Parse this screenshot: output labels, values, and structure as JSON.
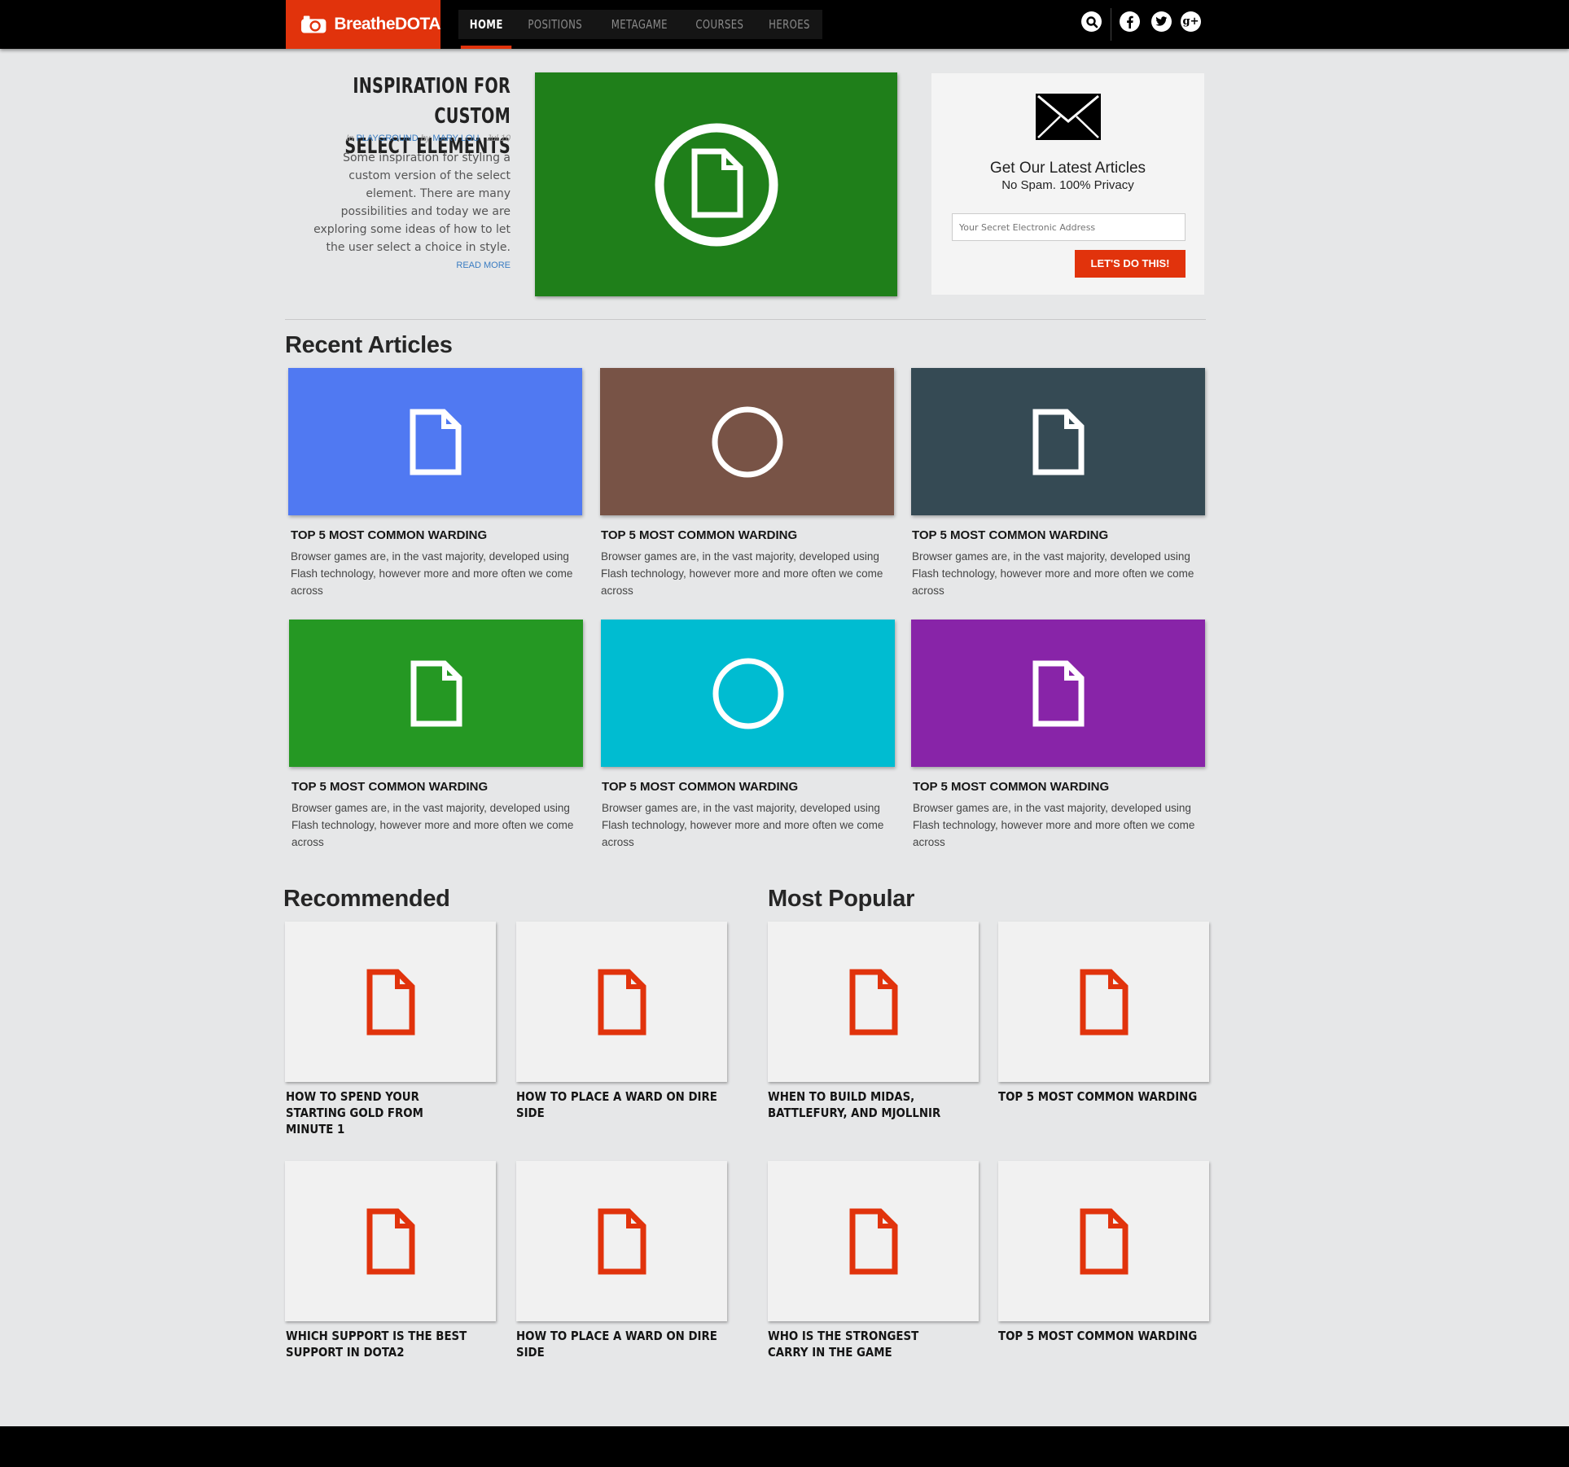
{
  "brand": {
    "name": "BreatheDOTA",
    "accent": "#e1330c"
  },
  "nav": [
    {
      "label": "HOME",
      "active": true
    },
    {
      "label": "POSITIONS",
      "active": false
    },
    {
      "label": "METAGAME",
      "active": false
    },
    {
      "label": "COURSES",
      "active": false
    },
    {
      "label": "HEROES",
      "active": false
    }
  ],
  "header_icons": [
    "search-icon",
    "facebook-icon",
    "twitter-icon",
    "google-plus-icon"
  ],
  "featured": {
    "title_line1": "INSPIRATION FOR CUSTOM",
    "title_line2": "SELECT ELEMENTS",
    "meta_in": "In",
    "category": "PLAYGROUND",
    "meta_by": "by",
    "author": "MARY LOU",
    "date": "Jul 10",
    "excerpt": "Some inspiration for styling a custom version of the select element. There are many possibilities and today we are exploring some ideas of how to let the user select a choice in style.",
    "read_more": "READ MORE",
    "tile_color": "#1f7f1a",
    "tile_icon": "document-circle-icon"
  },
  "newsletter": {
    "icon": "envelope-icon",
    "title": "Get Our Latest Articles",
    "subtitle": "No Spam. 100% Privacy",
    "placeholder": "Your Secret Electronic Address",
    "button": "LET'S DO THIS!"
  },
  "recent": {
    "heading": "Recent Articles",
    "cards": [
      {
        "title": "TOP 5 MOST COMMON WARDING",
        "excerpt": "Browser games are, in the vast majority, developed using Flash technology, however more and more often we come across",
        "color": "#5079f2",
        "icon": "document-icon"
      },
      {
        "title": "TOP 5 MOST COMMON WARDING",
        "excerpt": "Browser games are, in the vast majority, developed using Flash technology, however more and more often we come across",
        "color": "#785346",
        "icon": "circle-icon"
      },
      {
        "title": "TOP 5 MOST COMMON WARDING",
        "excerpt": "Browser games are, in the vast majority, developed using Flash technology, however more and more often we come across",
        "color": "#354a54",
        "icon": "document-icon"
      },
      {
        "title": "TOP 5 MOST COMMON WARDING",
        "excerpt": "Browser games are, in the vast majority, developed using Flash technology, however more and more often we come across",
        "color": "#259823",
        "icon": "document-icon"
      },
      {
        "title": "TOP 5 MOST COMMON WARDING",
        "excerpt": "Browser games are, in the vast majority, developed using Flash technology, however more and more often we come across",
        "color": "#00bcd1",
        "icon": "circle-icon"
      },
      {
        "title": "TOP 5 MOST COMMON WARDING",
        "excerpt": "Browser games are, in the vast majority, developed using Flash technology, however more and more often we come across",
        "color": "#8824a8",
        "icon": "document-icon"
      }
    ]
  },
  "recommended": {
    "heading": "Recommended",
    "items": [
      {
        "title": "HOW TO SPEND YOUR STARTING GOLD FROM MINUTE 1",
        "icon": "document-icon"
      },
      {
        "title": "HOW TO PLACE A WARD ON DIRE SIDE",
        "icon": "document-icon"
      },
      {
        "title": "WHICH SUPPORT IS THE BEST SUPPORT IN DOTA2",
        "icon": "document-icon"
      },
      {
        "title": "HOW TO PLACE A WARD ON DIRE SIDE",
        "icon": "document-icon"
      }
    ]
  },
  "popular": {
    "heading": "Most Popular",
    "items": [
      {
        "title": "WHEN TO BUILD MIDAS, BATTLEFURY, AND MJOLLNIR",
        "icon": "document-icon"
      },
      {
        "title": "TOP 5 MOST COMMON WARDING",
        "icon": "document-icon"
      },
      {
        "title": "WHO IS THE STRONGEST CARRY IN THE GAME",
        "icon": "document-icon"
      },
      {
        "title": "TOP 5 MOST COMMON WARDING",
        "icon": "document-icon"
      }
    ]
  }
}
